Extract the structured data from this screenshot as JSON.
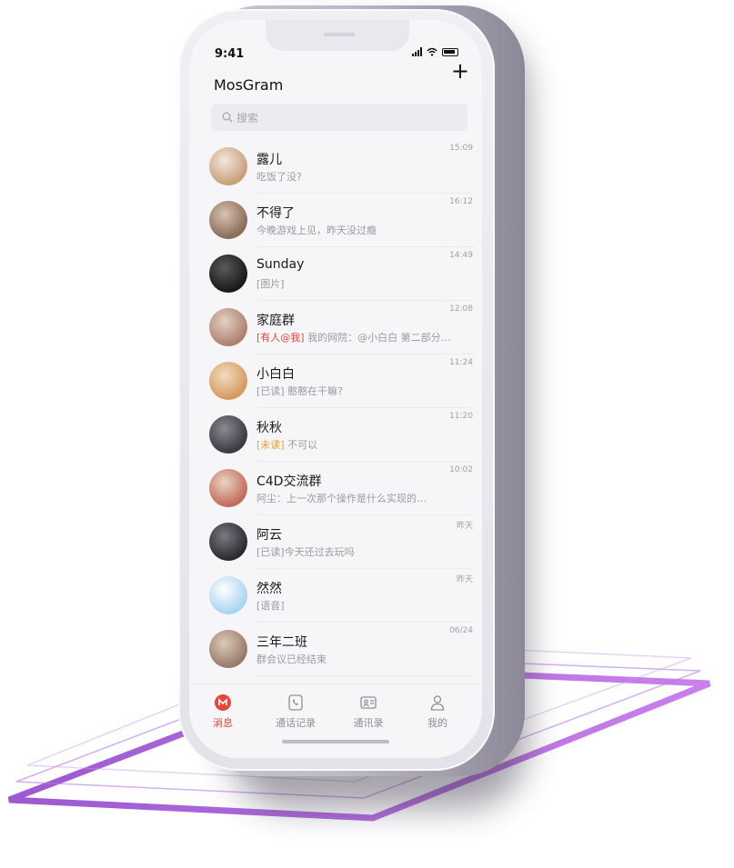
{
  "status": {
    "time": "9:41"
  },
  "header": {
    "title": "MosGram",
    "add_icon": "plus-icon"
  },
  "search": {
    "placeholder": "搜索"
  },
  "chats": [
    {
      "name": "露儿",
      "preview": "吃饭了没?",
      "time": "15:09",
      "avatar_colors": [
        "#c9a07a",
        "#f3e6dc"
      ]
    },
    {
      "name": "不得了",
      "preview": "今晚游戏上见，昨天没过瘾",
      "time": "16:12",
      "avatar_colors": [
        "#8a6c5a",
        "#d8c2b0"
      ]
    },
    {
      "name": "Sunday",
      "preview": "[图片]",
      "time": "14:49",
      "avatar_colors": [
        "#1a1a1a",
        "#5a5a5a"
      ]
    },
    {
      "name": "家庭群",
      "tag": "[有人@我]",
      "tag_color": "#e8453c",
      "preview": "我的网院：@小白白 第二部分…",
      "time": "12:08",
      "avatar_colors": [
        "#b08070",
        "#e2d0c4"
      ]
    },
    {
      "name": "小白白",
      "preview": "[已读] 憨憨在干嘛?",
      "time": "11:24",
      "avatar_colors": [
        "#d59a5c",
        "#f1dcc4"
      ]
    },
    {
      "name": "秋秋",
      "tag": "[未读]",
      "tag_color": "#f0a020",
      "preview": "不可以",
      "time": "11:20",
      "avatar_colors": [
        "#3a3a42",
        "#8a8a92"
      ]
    },
    {
      "name": "C4D交流群",
      "preview": "阿尘：上一次那个操作是什么实现的…",
      "time": "10:02",
      "avatar_colors": [
        "#c46a5a",
        "#e6d6c2"
      ]
    },
    {
      "name": "阿云",
      "preview": "[已读]今天还过去玩吗",
      "time": "昨天",
      "avatar_colors": [
        "#2a2a30",
        "#7a7a82"
      ]
    },
    {
      "name": "然然",
      "preview": "[语音]",
      "time": "昨天",
      "avatar_colors": [
        "#a9d4ef",
        "#ffffff"
      ]
    },
    {
      "name": "三年二班",
      "preview": "群会议已经结束",
      "time": "06/24",
      "avatar_colors": [
        "#9a7a6a",
        "#dccab8"
      ]
    }
  ],
  "tabs": [
    {
      "label": "消息",
      "icon": "message-icon",
      "active": true
    },
    {
      "label": "通话记录",
      "icon": "phone-call-icon",
      "active": false
    },
    {
      "label": "通讯录",
      "icon": "contacts-icon",
      "active": false
    },
    {
      "label": "我的",
      "icon": "profile-icon",
      "active": false
    }
  ],
  "colors": {
    "accent": "#e8453c",
    "tag_orange": "#f0a020",
    "deco_purple": "#a24fd8"
  }
}
